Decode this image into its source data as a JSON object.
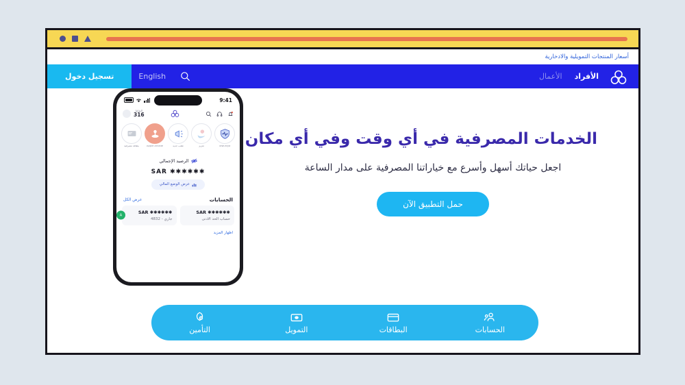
{
  "window": {
    "controls": [
      {
        "name": "circle",
        "shape": "circle"
      },
      {
        "name": "square",
        "shape": "square"
      },
      {
        "name": "triangle",
        "shape": "triangle"
      }
    ],
    "address_value": ""
  },
  "utility_bar": {
    "link": "أسعار المنتجات التمويلية والادخارية"
  },
  "navbar": {
    "logo_name": "bank-trefoil-logo",
    "segments": [
      {
        "label": "الأفراد",
        "active": true
      },
      {
        "label": "الأعمال",
        "active": false
      }
    ],
    "search_icon": "search-icon",
    "language_label": "English",
    "login_label": "تسجيل دخول",
    "bg_color": "#2222e6",
    "login_color": "#19b9f0"
  },
  "hero": {
    "title": "الخدمات المصرفية في أي وقت وفي أي مكان",
    "subtitle": "اجعل حياتك أسهل وأسرع مع خياراتنا المصرفية على مدار الساعة",
    "cta_label": "حمل التطبيق الآن",
    "title_color": "#3a29ab",
    "cta_color": "#1eb6f2"
  },
  "phone": {
    "status": {
      "time": "9:41",
      "signal_icon": "signal-bars-icon",
      "wifi_icon": "wifi-icon",
      "battery_icon": "battery-icon"
    },
    "toolbar": {
      "icons": [
        "notification-bell-icon",
        "headphones-support-icon",
        "search-icon"
      ],
      "center_logo": "bank-trefoil-logo",
      "points_label": "النقاط",
      "points_value": "316",
      "avatar": "user-avatar"
    },
    "shortcuts": [
      {
        "label": "Tawuniya",
        "icon": "shield-health-icon"
      },
      {
        "label": "تعزيز",
        "icon": "hand-care-icon"
      },
      {
        "label": "طلب جديد",
        "icon": "megaphone-icon"
      },
      {
        "label": "Apple Arcade",
        "icon": "joystick-icon"
      },
      {
        "label": "بطاقة مصرفية",
        "icon": "card-icon"
      }
    ],
    "balance": {
      "label": "الرصيد الإجمالي",
      "eye_icon": "eye-hidden-icon",
      "amount": "✱✱✱✱✱✱ SAR",
      "fin_button": "عرض الوضع المالي",
      "fin_icon": "chart-bars-icon"
    },
    "accounts": {
      "title": "الحسابات",
      "view_all": "عرض الكل",
      "cards": [
        {
          "balance": "✱✱✱✱✱✱ SAR",
          "name": "جاري - 4832",
          "badge": "A"
        },
        {
          "balance": "✱✱✱✱✱✱ SAR",
          "name": "حساب الحد الأدنى",
          "badge": ""
        }
      ],
      "show_more": "اظهار المزيد"
    }
  },
  "app_tabs": [
    {
      "label": "الحسابات",
      "icon": "accounts-person-icon"
    },
    {
      "label": "البطاقات",
      "icon": "credit-card-icon"
    },
    {
      "label": "التمويل",
      "icon": "money-bill-icon"
    },
    {
      "label": "التأمين",
      "icon": "insurance-shield-icon"
    }
  ],
  "colors": {
    "page_bg": "#dfe6ed",
    "titlebar": "#f7d754",
    "address": "#e8744f",
    "tabbar": "#2ab6ee"
  }
}
